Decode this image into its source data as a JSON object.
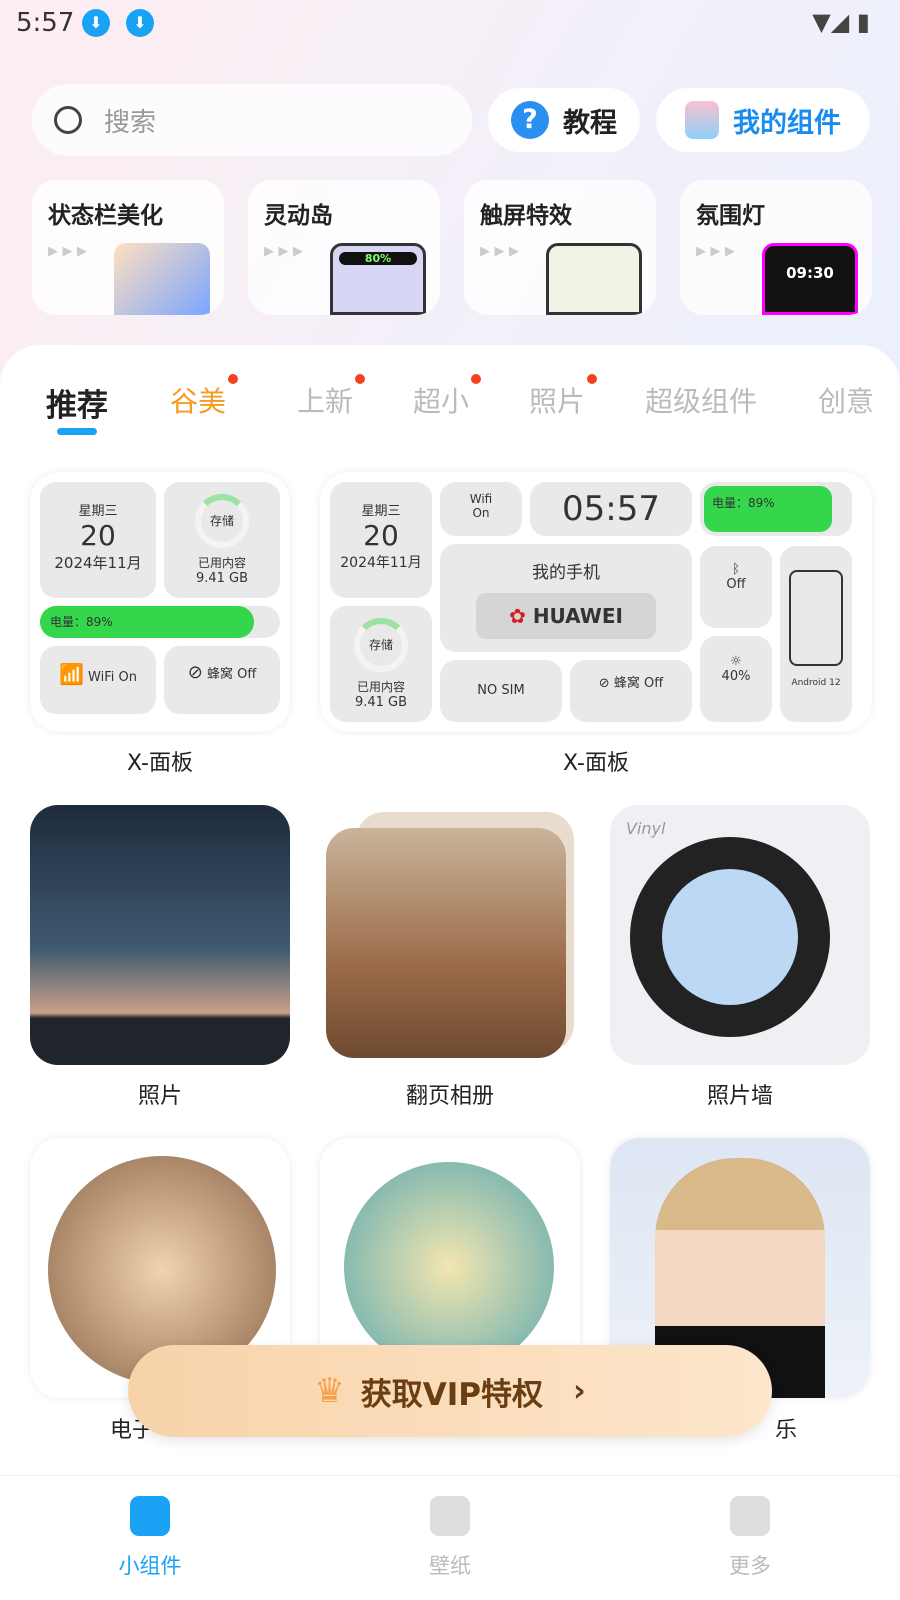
{
  "status": {
    "time": "5:57",
    "download_icons": 2
  },
  "search": {
    "placeholder": "搜索"
  },
  "header": {
    "tutorial": "教程",
    "my_widgets": "我的组件"
  },
  "features": [
    {
      "label": "状态栏美化"
    },
    {
      "label": "灵动岛",
      "badge": "80%"
    },
    {
      "label": "触屏特效"
    },
    {
      "label": "氛围灯",
      "clock": "09:30"
    }
  ],
  "tabs": [
    {
      "label": "推荐",
      "active": true
    },
    {
      "label": "谷美",
      "dot": true
    },
    {
      "label": "上新",
      "dot": true
    },
    {
      "label": "超小",
      "dot": true
    },
    {
      "label": "照片",
      "dot": true
    },
    {
      "label": "超级组件"
    },
    {
      "label": "创意"
    }
  ],
  "widget_small": {
    "weekday": "星期三",
    "day": "20",
    "month": "2024年11月",
    "storage": "存储",
    "used": "已用内容",
    "used_value": "9.41 GB",
    "battery": "电量：89%",
    "battery_level": 89,
    "wifi": "WiFi",
    "wifi_state": "On",
    "cell": "蜂窝",
    "cell_state": "Off",
    "label": "X-面板"
  },
  "widget_large": {
    "weekday": "星期三",
    "day": "20",
    "month": "2024年11月",
    "wifi": "Wifi",
    "wifi_state": "On",
    "clock": "05:57",
    "battery": "电量：89%",
    "phone": "我的手机",
    "brand": "HUAWEI",
    "bt_state": "Off",
    "brightness": "40%",
    "android": "Android 12",
    "storage": "存储",
    "used": "已用内容",
    "used_value": "9.41 GB",
    "sim": "NO SIM",
    "cell": "蜂窝",
    "cell_state": "Off",
    "label": "X-面板"
  },
  "row2": [
    {
      "label": "照片"
    },
    {
      "label": "翻页相册"
    },
    {
      "label": "照片墙",
      "vinyl": "Vinyl"
    }
  ],
  "row3": [
    {
      "label": "电子"
    },
    {
      "label": ""
    },
    {
      "label": "乐"
    }
  ],
  "vip": {
    "label": "获取VIP特权"
  },
  "nav": [
    {
      "label": "小组件",
      "active": true
    },
    {
      "label": "壁纸"
    },
    {
      "label": "更多"
    }
  ],
  "colors": {
    "accent": "#1aa3f5",
    "tab_active_alt": "#f59a23",
    "battery": "#34d64c",
    "dot": "#f4421e"
  }
}
